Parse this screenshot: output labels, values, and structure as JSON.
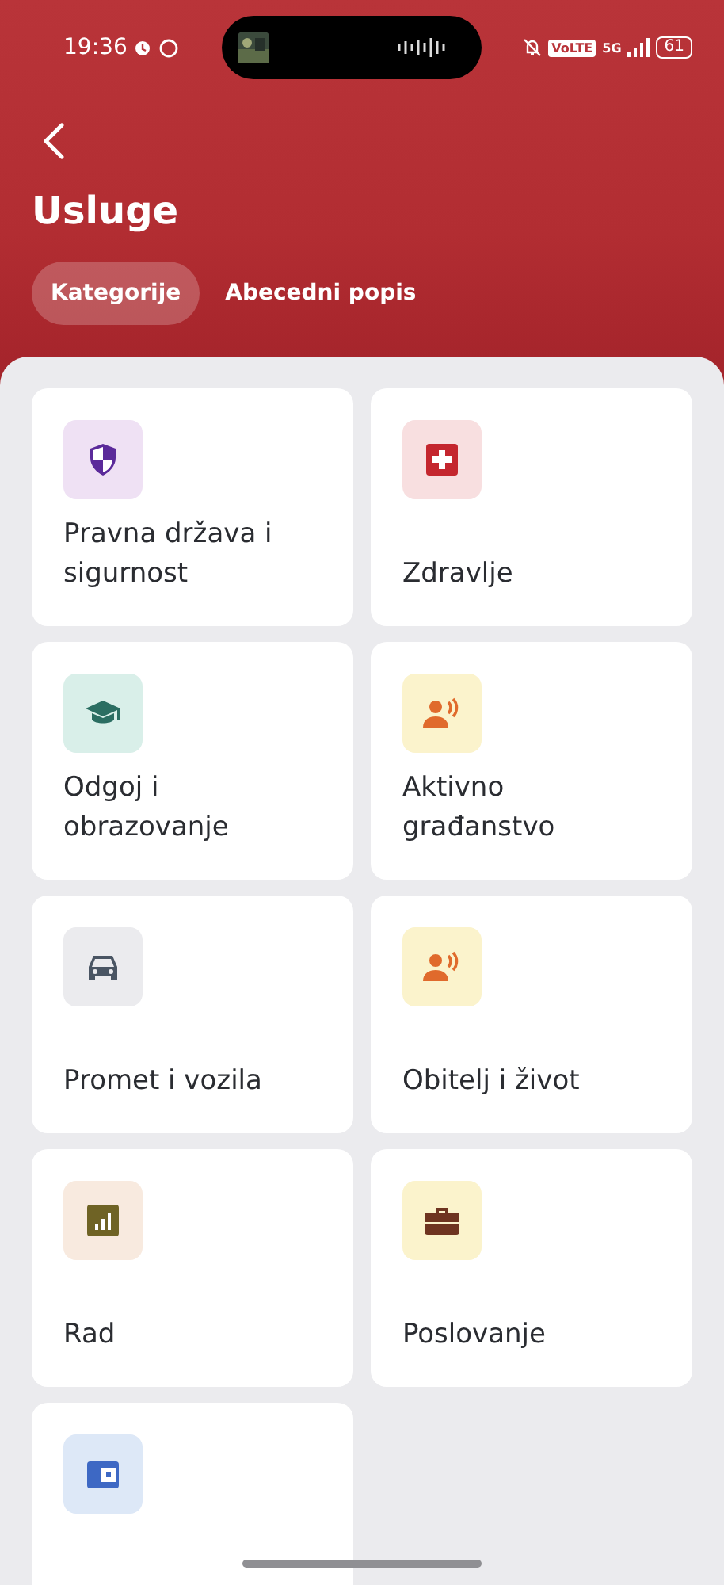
{
  "status_bar": {
    "time": "19:36",
    "network": "VoLTE",
    "generation": "5G",
    "battery": "61"
  },
  "header": {
    "title": "Usluge"
  },
  "tabs": [
    {
      "label": "Kategorije",
      "selected": true
    },
    {
      "label": "Abecedni popis",
      "selected": false
    }
  ],
  "categories": [
    {
      "label": "Pravna država i sigurnost",
      "kind": "shield",
      "color": "#5b2a9a"
    },
    {
      "label": "Zdravlje",
      "kind": "health",
      "color": "#c4262e"
    },
    {
      "label": "Odgoj i obrazovanje",
      "kind": "education",
      "color": "#2b6e62"
    },
    {
      "label": "Aktivno građanstvo",
      "kind": "speaker",
      "color": "#e06a2c"
    },
    {
      "label": "Promet i vozila",
      "kind": "car",
      "color": "#4a5563"
    },
    {
      "label": "Obitelj i život",
      "kind": "speaker",
      "color": "#e06a2c"
    },
    {
      "label": "Rad",
      "kind": "chart",
      "color": "#6f6325"
    },
    {
      "label": "Poslovanje",
      "kind": "briefcase",
      "color": "#6e3420"
    },
    {
      "kind": "wallet",
      "color": "#3d68c4"
    }
  ]
}
